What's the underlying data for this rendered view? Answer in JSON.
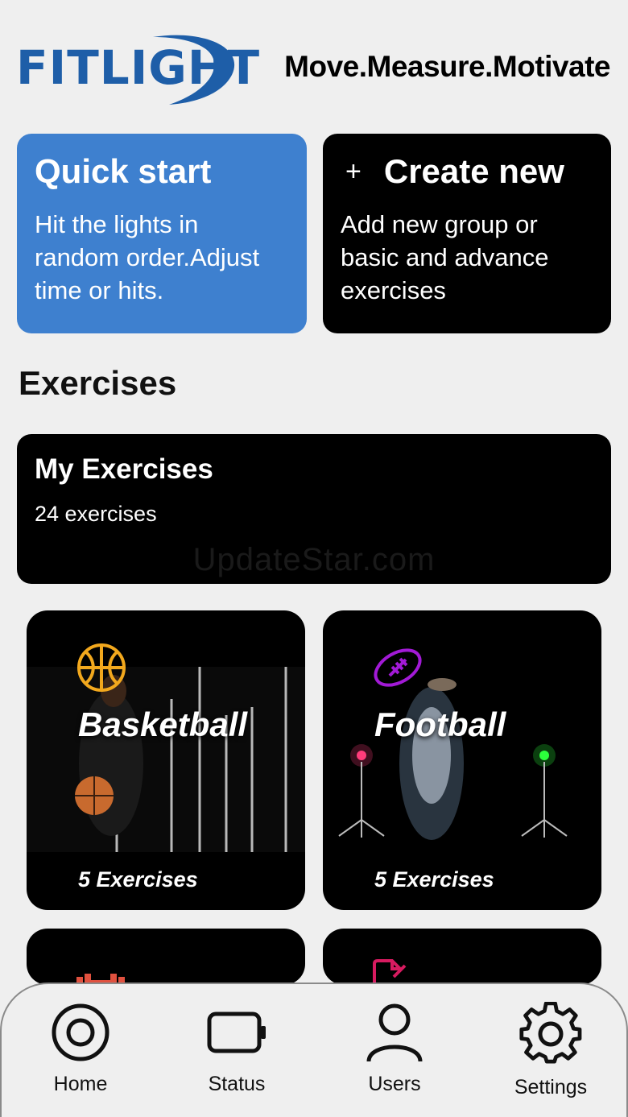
{
  "header": {
    "logo_text": "FITLIGHT",
    "tagline": "Move.Measure.Motivate"
  },
  "cards": {
    "quick_start": {
      "title": "Quick start",
      "description": "Hit the lights in random order.Adjust time or hits."
    },
    "create_new": {
      "plus": "+",
      "title": "Create new",
      "description": "Add new group or basic and advance exercises"
    }
  },
  "exercises": {
    "section_title": "Exercises",
    "my_exercises": {
      "title": "My Exercises",
      "count": "24 exercises",
      "watermark": "UpdateStar.com"
    },
    "categories": [
      {
        "name": "Basketball",
        "count": "5 Exercises",
        "icon": "basketball-icon",
        "icon_color": "#f2a81d"
      },
      {
        "name": "Football",
        "count": "5 Exercises",
        "icon": "football-icon",
        "icon_color": "#a21ad6"
      },
      {
        "name": "",
        "count": "",
        "icon": "dumbbell-icon",
        "icon_color": "#e0513f"
      },
      {
        "name": "",
        "count": "",
        "icon": "clipboard-icon",
        "icon_color": "#d81b60"
      }
    ]
  },
  "tabbar": {
    "items": [
      {
        "label": "Home",
        "icon": "home-target-icon"
      },
      {
        "label": "Status",
        "icon": "battery-icon"
      },
      {
        "label": "Users",
        "icon": "user-icon"
      },
      {
        "label": "Settings",
        "icon": "gear-icon"
      }
    ]
  },
  "colors": {
    "brand_blue": "#1e5ea8",
    "quick_start_bg": "#3e80cf",
    "card_dark": "#000000",
    "page_bg": "#efefef"
  }
}
